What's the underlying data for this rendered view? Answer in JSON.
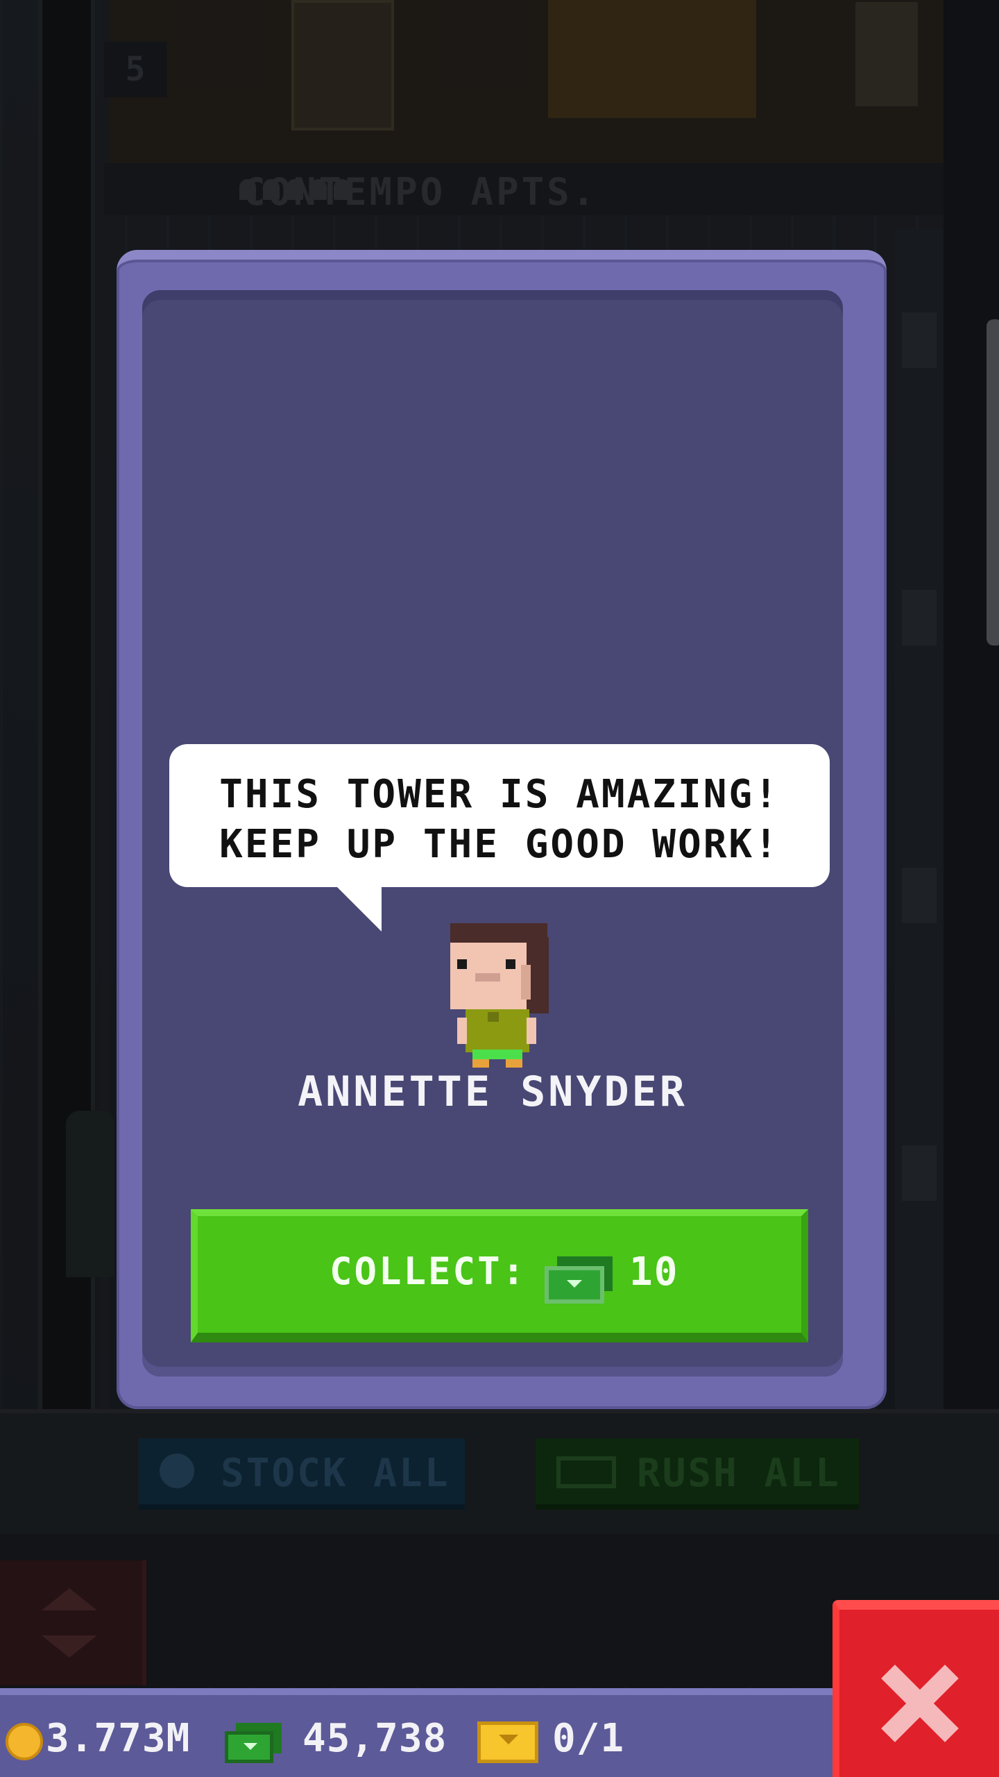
{
  "background": {
    "floor_number": "5",
    "floor_name": "CONTEMPO APTS.",
    "stock_all_label": "STOCK ALL",
    "rush_all_label": "RUSH ALL"
  },
  "popup": {
    "speech_line_1": "THIS TOWER IS AMAZING!",
    "speech_line_2": "KEEP UP THE GOOD WORK!",
    "npc_name": "ANNETTE SNYDER",
    "collect_label": "COLLECT:",
    "collect_icon": "bux-icon",
    "collect_amount": "10"
  },
  "currency": {
    "coins": "3.773M",
    "bux": "45,738",
    "tickets": "0/1"
  },
  "colors": {
    "card": "#6e6aad",
    "card_inner": "#494774",
    "collect_button": "#49c417",
    "close_button": "#e0202a"
  }
}
